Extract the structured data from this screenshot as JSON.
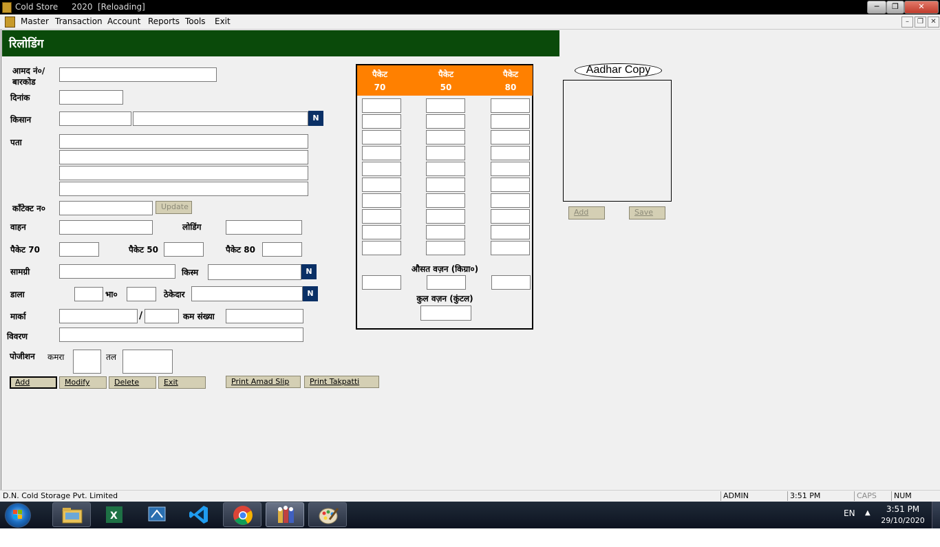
{
  "window": {
    "app": "Cold Store",
    "year": "2020",
    "state": "[Reloading]"
  },
  "menu": [
    "Master",
    "Transaction",
    "Account",
    "Reports",
    "Tools",
    "Exit"
  ],
  "header": {
    "title": "रिलोडिंग"
  },
  "labels": {
    "amad_no_1": "आमद नं०/",
    "amad_no_2": "बारकोड",
    "dinank": "दिनांक",
    "kisan": "किसान",
    "pata": "पता",
    "contact": "कॉंटेक्ट न०",
    "vahan": "वाहन",
    "loading": "लोडिंग",
    "packet70": "पैकेट 70",
    "packet50": "पैकेट 50",
    "packet80": "पैकेट 80",
    "samagri": "सामग्री",
    "kism": "किस्म",
    "dala": "डाला",
    "bhao": "भा०",
    "thekedar": "ठेकेदार",
    "marka": "मार्का",
    "slash": "/",
    "kam_sankhya": "कम संख्या",
    "vivaran": "विवरण",
    "position": "पोजीशन",
    "kamra": "कमरा",
    "tal": "तल"
  },
  "n_button": "N",
  "buttons": {
    "update": "Update",
    "add": "Add",
    "modify": "Modify",
    "delete": "Delete",
    "exit": "Exit",
    "print_amad": "Print Amad Slip",
    "print_takpatti": "Print Takpatti"
  },
  "packet_panel": {
    "columns": [
      {
        "title": "पैकेट",
        "size": "70"
      },
      {
        "title": "पैकेट",
        "size": "50"
      },
      {
        "title": "पैकेट",
        "size": "80"
      }
    ],
    "rows": 10,
    "avg_weight_label": "औसत वज़न (किग्रा०)",
    "total_weight_label": "कुल वज़न (कुंटल)"
  },
  "aadhar": {
    "title": "Aadhar Copy",
    "add": "Add",
    "save": "Save"
  },
  "status": {
    "company": "D.N. Cold Storage Pvt. Limited",
    "user": "ADMIN",
    "time": "3:51 PM",
    "caps": "CAPS",
    "num": "NUM"
  },
  "taskbar": {
    "lang": "EN",
    "clock_time": "3:51 PM",
    "clock_date": "29/10/2020"
  },
  "colors": {
    "header_green": "#0a4a0a",
    "packet_orange": "#ff8000",
    "n_blue": "#0a3066",
    "button_khaki": "#d4cfb4"
  }
}
